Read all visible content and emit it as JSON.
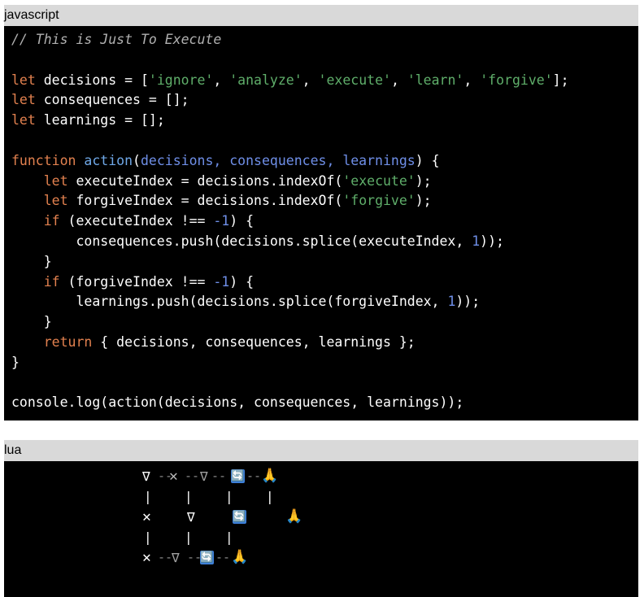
{
  "blocks": [
    {
      "language": "javascript",
      "lines": [
        [
          {
            "t": "cm",
            "v": "// This is Just To Execute"
          }
        ],
        [],
        [
          {
            "t": "kw",
            "v": "let"
          },
          {
            "t": "pn",
            "v": " decisions = ["
          },
          {
            "t": "st",
            "v": "'ignore'"
          },
          {
            "t": "pn",
            "v": ", "
          },
          {
            "t": "st",
            "v": "'analyze'"
          },
          {
            "t": "pn",
            "v": ", "
          },
          {
            "t": "st",
            "v": "'execute'"
          },
          {
            "t": "pn",
            "v": ", "
          },
          {
            "t": "st",
            "v": "'learn'"
          },
          {
            "t": "pn",
            "v": ", "
          },
          {
            "t": "st",
            "v": "'forgive'"
          },
          {
            "t": "pn",
            "v": "];"
          }
        ],
        [
          {
            "t": "kw",
            "v": "let"
          },
          {
            "t": "pn",
            "v": " consequences = [];"
          }
        ],
        [
          {
            "t": "kw",
            "v": "let"
          },
          {
            "t": "pn",
            "v": " learnings = [];"
          }
        ],
        [],
        [
          {
            "t": "kw",
            "v": "function"
          },
          {
            "t": "pn",
            "v": " "
          },
          {
            "t": "fn",
            "v": "action"
          },
          {
            "t": "pn",
            "v": "("
          },
          {
            "t": "pm",
            "v": "decisions, consequences, learnings"
          },
          {
            "t": "pn",
            "v": ") {"
          }
        ],
        [
          {
            "t": "pn",
            "v": "    "
          },
          {
            "t": "kw",
            "v": "let"
          },
          {
            "t": "pn",
            "v": " executeIndex = decisions.indexOf("
          },
          {
            "t": "st",
            "v": "'execute'"
          },
          {
            "t": "pn",
            "v": ");"
          }
        ],
        [
          {
            "t": "pn",
            "v": "    "
          },
          {
            "t": "kw",
            "v": "let"
          },
          {
            "t": "pn",
            "v": " forgiveIndex = decisions.indexOf("
          },
          {
            "t": "st",
            "v": "'forgive'"
          },
          {
            "t": "pn",
            "v": ");"
          }
        ],
        [
          {
            "t": "pn",
            "v": "    "
          },
          {
            "t": "kw",
            "v": "if"
          },
          {
            "t": "pn",
            "v": " (executeIndex !== "
          },
          {
            "t": "nm",
            "v": "-1"
          },
          {
            "t": "pn",
            "v": ") {"
          }
        ],
        [
          {
            "t": "pn",
            "v": "        consequences.push(decisions.splice(executeIndex, "
          },
          {
            "t": "nm",
            "v": "1"
          },
          {
            "t": "pn",
            "v": "));"
          }
        ],
        [
          {
            "t": "pn",
            "v": "    }"
          }
        ],
        [
          {
            "t": "pn",
            "v": "    "
          },
          {
            "t": "kw",
            "v": "if"
          },
          {
            "t": "pn",
            "v": " (forgiveIndex !== "
          },
          {
            "t": "nm",
            "v": "-1"
          },
          {
            "t": "pn",
            "v": ") {"
          }
        ],
        [
          {
            "t": "pn",
            "v": "        learnings.push(decisions.splice(forgiveIndex, "
          },
          {
            "t": "nm",
            "v": "1"
          },
          {
            "t": "pn",
            "v": "));"
          }
        ],
        [
          {
            "t": "pn",
            "v": "    }"
          }
        ],
        [
          {
            "t": "pn",
            "v": "    "
          },
          {
            "t": "kw",
            "v": "return"
          },
          {
            "t": "pn",
            "v": " { decisions, consequences, learnings };"
          }
        ],
        [
          {
            "t": "pn",
            "v": "}"
          }
        ],
        [],
        [
          {
            "t": "pn",
            "v": "console.log(action(decisions, consequences, learnings));"
          }
        ]
      ]
    },
    {
      "language": "lua",
      "ascii_rows": [
        [
          {
            "k": "tri",
            "v": "∇"
          },
          {
            "k": "dash",
            "v": "--"
          },
          {
            "k": "x-dim",
            "v": "✕"
          },
          {
            "k": "dash",
            "v": "--"
          },
          {
            "k": "tri-dim",
            "v": "∇"
          },
          {
            "k": "dash",
            "v": "--"
          },
          {
            "k": "cycle",
            "v": "🔄"
          },
          {
            "k": "dash",
            "v": "--"
          },
          {
            "k": "pray",
            "v": "🙏"
          }
        ],
        [
          {
            "k": "bar",
            "v": "|"
          },
          {
            "k": "bar",
            "v": "|"
          },
          {
            "k": "bar",
            "v": "|"
          },
          {
            "k": "bar",
            "v": "|"
          }
        ],
        [
          {
            "k": "x",
            "v": "✕"
          },
          {
            "k": "tri",
            "v": "∇"
          },
          {
            "k": "cycle",
            "v": "🔄"
          },
          {
            "k": "pray",
            "v": "🙏"
          }
        ],
        [
          {
            "k": "bar",
            "v": "|"
          },
          {
            "k": "bar",
            "v": "|"
          },
          {
            "k": "bar",
            "v": "|"
          }
        ],
        [
          {
            "k": "x",
            "v": "✕"
          },
          {
            "k": "dash",
            "v": "--"
          },
          {
            "k": "tri-dim",
            "v": "∇"
          },
          {
            "k": "dash",
            "v": "--"
          },
          {
            "k": "cycle",
            "v": "🔄"
          },
          {
            "k": "dash",
            "v": "--"
          },
          {
            "k": "pray",
            "v": "🙏"
          }
        ]
      ]
    }
  ]
}
